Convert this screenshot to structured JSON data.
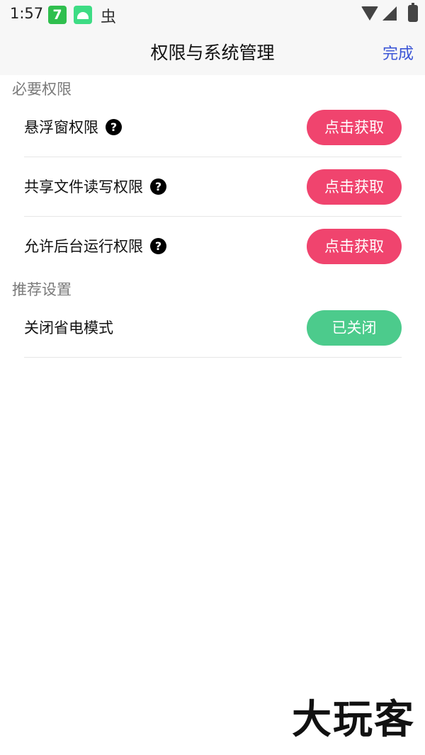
{
  "status_bar": {
    "time": "1:57",
    "icons": [
      "green-7-app-icon",
      "android-icon",
      "bug-icon",
      "wifi-icon",
      "cellular-icon",
      "battery-icon"
    ]
  },
  "header": {
    "title": "权限与系统管理",
    "done_label": "完成",
    "done_color": "#3b55d6"
  },
  "sections": {
    "required": {
      "title": "必要权限",
      "items": [
        {
          "label": "悬浮窗权限",
          "button": "点击获取"
        },
        {
          "label": "共享文件读写权限",
          "button": "点击获取"
        },
        {
          "label": "允许后台运行权限",
          "button": "点击获取"
        }
      ],
      "button_color": "#f0446e"
    },
    "recommended": {
      "title": "推荐设置",
      "items": [
        {
          "label": "关闭省电模式",
          "button": "已关闭"
        }
      ],
      "button_color": "#4ccb8c"
    }
  },
  "watermark": "大玩客"
}
